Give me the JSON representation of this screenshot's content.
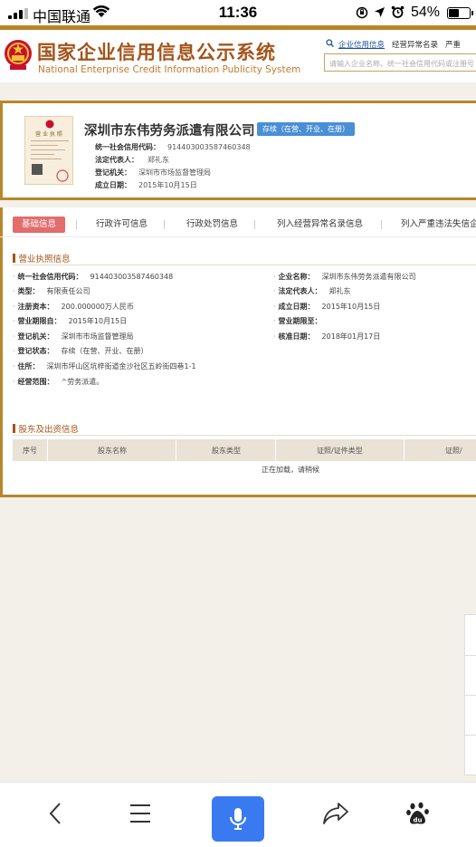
{
  "status_bar": {
    "carrier": "中国联通",
    "time": "11:36",
    "battery_percent": "54%",
    "battery_level": 0.54,
    "icons": [
      "signal-icon",
      "wifi-icon",
      "orientation-lock-icon",
      "location-icon",
      "alarm-icon",
      "battery-icon"
    ]
  },
  "site": {
    "title_cn": "国家企业信用信息公示系统",
    "title_en": "National Enterprise Credit Information Publicity System",
    "links": [
      "企业信用信息",
      "经营异常名录",
      "严重"
    ],
    "search_placeholder": "请输入企业名称、统一社会信用代码或注册号"
  },
  "company": {
    "license_thumb_title": "营 业 执 照",
    "name": "深圳市东伟劳务派遣有限公司",
    "status": "存续（在营、开业、在册）",
    "rows": [
      {
        "label": "统一社会信用代码：",
        "value": "914403003587460348"
      },
      {
        "label": "法定代表人：",
        "value": "郑礼东"
      },
      {
        "label": "登记机关：",
        "value": "深圳市市场监督管理局"
      },
      {
        "label": "成立日期：",
        "value": "2015年10月15日"
      }
    ]
  },
  "tabs": [
    "基础信息",
    "行政许可信息",
    "行政处罚信息",
    "列入经营异常名录信息",
    "列入严重违法失信企"
  ],
  "license_section": {
    "title": "营业执照信息",
    "left": [
      {
        "label": "统一社会信用代码：",
        "value": "914403003587460348"
      },
      {
        "label": "类型：",
        "value": "有限责任公司"
      },
      {
        "label": "注册资本：",
        "value": "200.000000万人民币"
      },
      {
        "label": "营业期限自：",
        "value": "2015年10月15日"
      },
      {
        "label": "登记机关：",
        "value": "深圳市市场监督管理局"
      },
      {
        "label": "登记状态：",
        "value": "存续（在营、开业、在册）"
      },
      {
        "label": "住所：",
        "value": "深圳市坪山区坑梓街道金沙社区五岭街四巷1-1"
      },
      {
        "label": "经营范围：",
        "value": "^劳务派遣。"
      }
    ],
    "right": [
      {
        "label": "企业名称：",
        "value": "深圳市东伟劳务派遣有限公司"
      },
      {
        "label": "法定代表人：",
        "value": "郑礼东"
      },
      {
        "label": "成立日期：",
        "value": "2015年10月15日"
      },
      {
        "label": "营业期限至：",
        "value": ""
      },
      {
        "label": "核准日期：",
        "value": "2018年01月17日"
      }
    ]
  },
  "shareholder_section": {
    "title": "股东及出资信息",
    "columns": [
      "序号",
      "股东名称",
      "股东类型",
      "证照/证件类型",
      "证照/"
    ],
    "loading_text": "正在加载，请稍候"
  },
  "bottom_bar": {
    "buttons": [
      "back-icon",
      "menu-icon",
      "mic-icon",
      "share-icon",
      "baidu-icon"
    ],
    "mic_color": "#3a7af0"
  },
  "colors": {
    "brand": "#b8862b",
    "title": "#a4541a",
    "active_tab": "#e36c6c",
    "status_badge": "#4a8fd6"
  }
}
